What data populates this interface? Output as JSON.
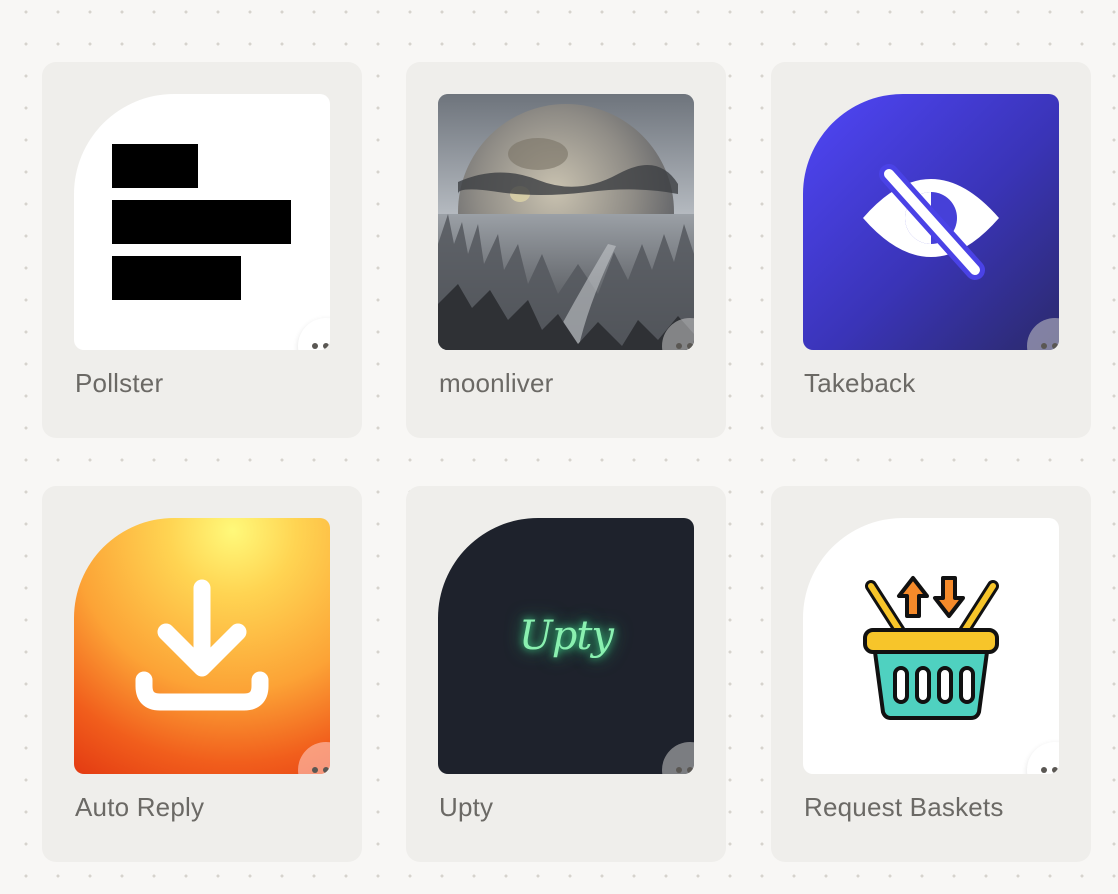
{
  "apps": [
    {
      "name": "Pollster",
      "icon": "pollster-bars-icon"
    },
    {
      "name": "moonliver",
      "icon": "moon-landscape-image"
    },
    {
      "name": "Takeback",
      "icon": "eye-slash-icon",
      "colors": [
        "#5046f8",
        "#2b2a6b"
      ]
    },
    {
      "name": "Auto Reply",
      "icon": "download-tray-icon",
      "colors": [
        "#fff97a",
        "#e33a12"
      ]
    },
    {
      "name": "Upty",
      "icon": "upty-logo",
      "logo_text": "Upty",
      "colors": [
        "#1e222c",
        "#8af0b0"
      ]
    },
    {
      "name": "Request Baskets",
      "icon": "basket-icon"
    }
  ],
  "more_menu_icon": "more-horizontal-icon"
}
